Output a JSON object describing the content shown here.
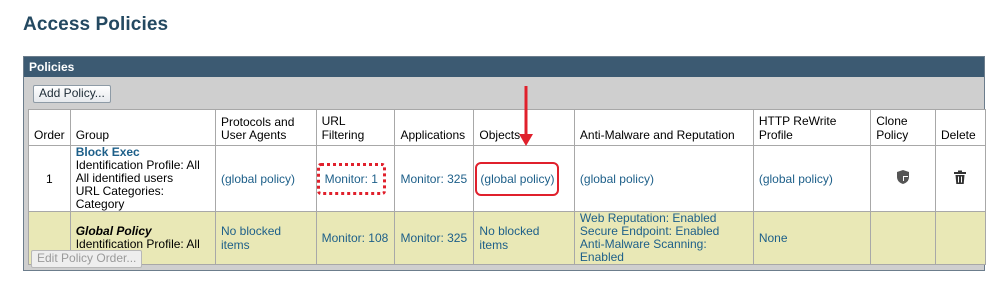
{
  "page": {
    "title": "Access Policies"
  },
  "panel": {
    "header": "Policies",
    "add_button": "Add Policy...",
    "edit_order_button": "Edit Policy Order..."
  },
  "table": {
    "headers": {
      "order": "Order",
      "group": "Group",
      "protocols": [
        "Protocols and",
        "User Agents"
      ],
      "url_filtering": "URL Filtering",
      "applications": "Applications",
      "objects": "Objects",
      "anti_malware": "Anti-Malware and Reputation",
      "http_rewrite": "HTTP ReWrite Profile",
      "clone": "Clone Policy",
      "delete": "Delete"
    },
    "rows": [
      {
        "order": "1",
        "group_name": "Block Exec",
        "group_lines": [
          "Identification Profile: All",
          "All identified users",
          "URL Categories: Category"
        ],
        "protocols": "(global policy)",
        "url_filtering": "Monitor: 1",
        "applications": "Monitor: 325",
        "objects": "(global policy)",
        "anti_malware": "(global policy)",
        "http_rewrite": "(global policy)",
        "clone_icon": "shield-icon",
        "delete_icon": "trash-icon"
      },
      {
        "order": "",
        "group_name": "Global Policy",
        "group_lines": [
          "Identification Profile: All"
        ],
        "protocols": "No blocked items",
        "url_filtering": "Monitor: 108",
        "applications": "Monitor: 325",
        "objects": "No blocked items",
        "anti_malware_lines": [
          "Web Reputation: Enabled",
          "Secure Endpoint: Enabled",
          "Anti-Malware Scanning: Enabled"
        ],
        "http_rewrite": "None"
      }
    ]
  },
  "annotation": {
    "color": "#e0202c"
  }
}
